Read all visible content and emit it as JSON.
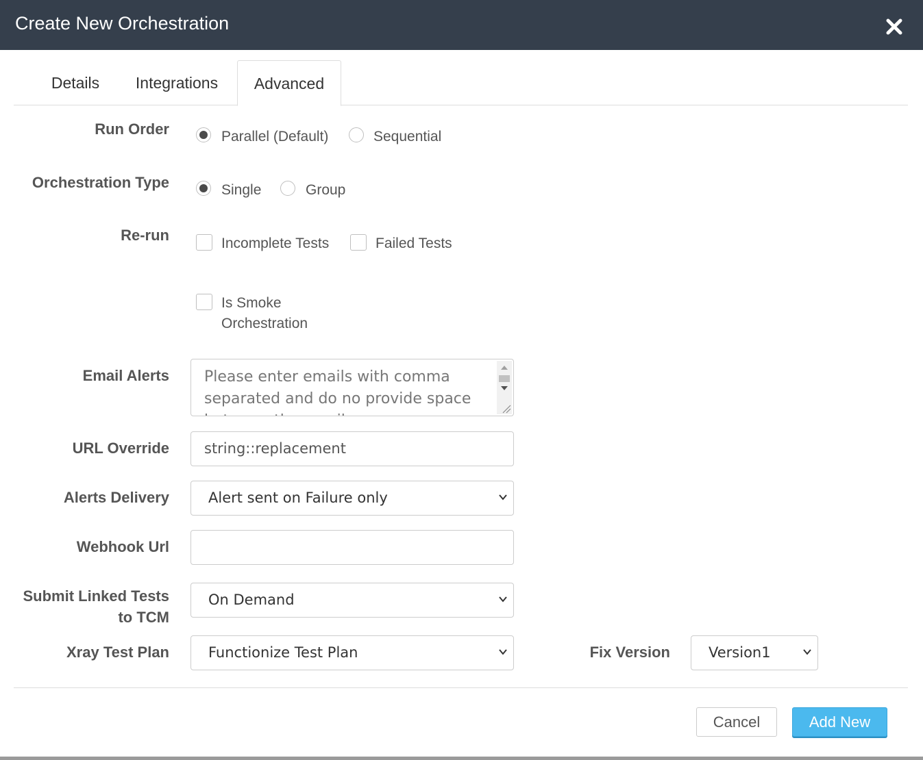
{
  "dialog": {
    "title": "Create New Orchestration"
  },
  "tabs": [
    {
      "label": "Details",
      "active": false
    },
    {
      "label": "Integrations",
      "active": false
    },
    {
      "label": "Advanced",
      "active": true
    }
  ],
  "run_order": {
    "label": "Run Order",
    "options": [
      {
        "label": "Parallel (Default)",
        "checked": true
      },
      {
        "label": "Sequential",
        "checked": false
      }
    ]
  },
  "orchestration_type": {
    "label": "Orchestration Type",
    "options": [
      {
        "label": "Single",
        "checked": true
      },
      {
        "label": "Group",
        "checked": false
      }
    ]
  },
  "rerun": {
    "label": "Re-run",
    "options": [
      {
        "label": "Incomplete Tests",
        "checked": false
      },
      {
        "label": "Failed Tests",
        "checked": false
      }
    ]
  },
  "smoke": {
    "line1": "Is Smoke",
    "line2": "Orchestration",
    "checked": false
  },
  "email_alerts": {
    "label": "Email Alerts",
    "placeholder": "Please enter emails with comma separated and do no provide space between the emails"
  },
  "url_override": {
    "label": "URL Override",
    "value": "string::replacement"
  },
  "alerts_delivery": {
    "label": "Alerts Delivery",
    "selected": "Alert sent on Failure only"
  },
  "webhook_url": {
    "label": "Webhook Url",
    "value": ""
  },
  "submit_linked": {
    "label_line1": "Submit Linked Tests",
    "label_line2": "to TCM",
    "selected": "On Demand"
  },
  "xray_test_plan": {
    "label": "Xray Test Plan",
    "selected": "Functionize Test Plan"
  },
  "fix_version": {
    "label": "Fix Version",
    "selected": "Version1"
  },
  "footer": {
    "cancel_label": "Cancel",
    "add_label": "Add New"
  },
  "colors": {
    "header_bg": "#353f4c",
    "primary_button": "#4bb9ee"
  }
}
